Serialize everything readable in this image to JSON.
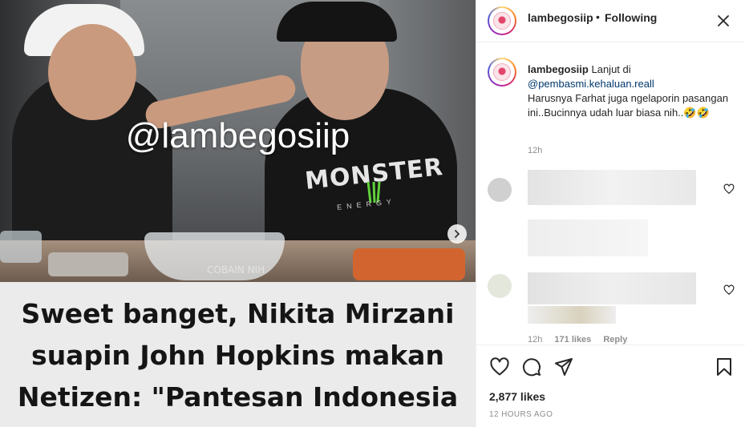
{
  "post": {
    "watermark": "@lambegosiip",
    "shirt_text": "MONSTER",
    "shirt_subtext": "ENERGY",
    "video_caption": "COBAIN NIH",
    "headline_lines": [
      "Sweet banget, Nikita Mirzani",
      "suapin John Hopkins makan",
      "Netizen: \"Pantesan Indonesia"
    ]
  },
  "header": {
    "username": "lambegosiip",
    "separator": "•",
    "follow_status": "Following",
    "avatar_text": "LAMBEGOSIIP"
  },
  "caption": {
    "username": "lambegosiip",
    "text_1": "Lanjut di",
    "mention": "@pembasmi.kehaluan.reall",
    "text_2": "Harusnya Farhat juga ngelaporin pasangan ini..Bucinnya udah luar biasa nih..🤣🤣",
    "timestamp": "12h"
  },
  "comment_meta": {
    "time": "12h",
    "likes": "171 likes",
    "reply": "Reply"
  },
  "footer": {
    "likes": "2,877 likes",
    "posted": "12 HOURS AGO"
  },
  "colors": {
    "link": "#00376b",
    "muted": "#8e8e8e",
    "text": "#262626"
  }
}
